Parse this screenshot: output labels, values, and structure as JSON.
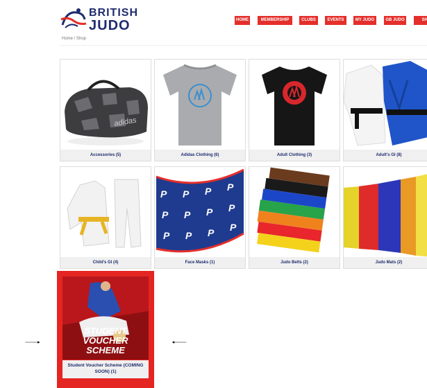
{
  "header": {
    "brand_line1": "BRITISH",
    "brand_line2": "JUDO",
    "nav": [
      "HOME",
      "MEMBERSHIP",
      "CLUBS",
      "EVENTS",
      "MY JUDO",
      "GB JUDO",
      "SHOP"
    ]
  },
  "breadcrumb": "Home / Shop",
  "categories": [
    "Accessories (5)",
    "Adidas Clothing (6)",
    "Adult Clothing (3)",
    "Adult's GI (8)",
    "Child's GI (4)",
    "Face Masks (1)",
    "Judo Belts (2)",
    "Judo Mats (2)"
  ],
  "voucher": {
    "poster_line1": "STUDENT VOUCHER",
    "poster_line2": "SCHEME",
    "label": "Student Voucher Scheme (COMING SOON) (1)"
  },
  "colors": {
    "nav_red": "#e42f2b",
    "brand_navy": "#1f2c6e",
    "highlight_red": "#e52521"
  }
}
